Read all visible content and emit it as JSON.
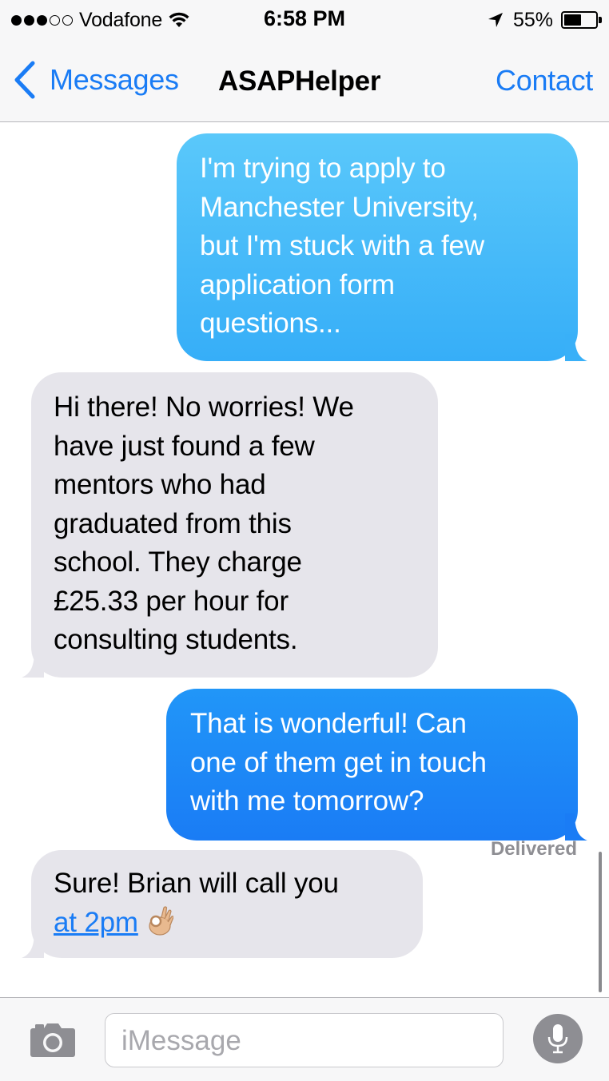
{
  "status_bar": {
    "carrier": "Vodafone",
    "time": "6:58 PM",
    "battery_percent": "55%",
    "battery_level": 0.55,
    "signal_bars": 3,
    "signal_max": 5
  },
  "nav": {
    "back_label": "Messages",
    "title": "ASAPHelper",
    "contact_label": "Contact"
  },
  "messages": [
    {
      "from": "me",
      "lines": [
        "I'm trying to apply to",
        "Manchester University,",
        "but I'm stuck with a few",
        "application form",
        "questions..."
      ]
    },
    {
      "from": "them",
      "lines": [
        "Hi there! No worries! We",
        "have just found a few",
        "mentors who had",
        "graduated from this",
        "school. They charge",
        "£25.33 per hour for",
        "consulting students."
      ]
    },
    {
      "from": "me",
      "lines": [
        "That is wonderful! Can",
        "one of them get in touch",
        "with me tomorrow?"
      ]
    },
    {
      "from": "them",
      "line1": "Sure! Brian will call you",
      "link": "at 2pm",
      "emoji": "ok-hand-emoji"
    }
  ],
  "delivered_label": "Delivered",
  "input": {
    "placeholder": "iMessage"
  },
  "colors": {
    "accent": "#1a7cf5",
    "sent_top": "#5ac8fa",
    "sent_bottom": "#1a7cf5",
    "received": "#e6e5eb",
    "bar_bg": "#f7f7f8"
  },
  "icons": [
    "wifi-icon",
    "location-arrow-icon",
    "battery-icon",
    "chevron-left-icon",
    "camera-icon",
    "microphone-icon"
  ]
}
